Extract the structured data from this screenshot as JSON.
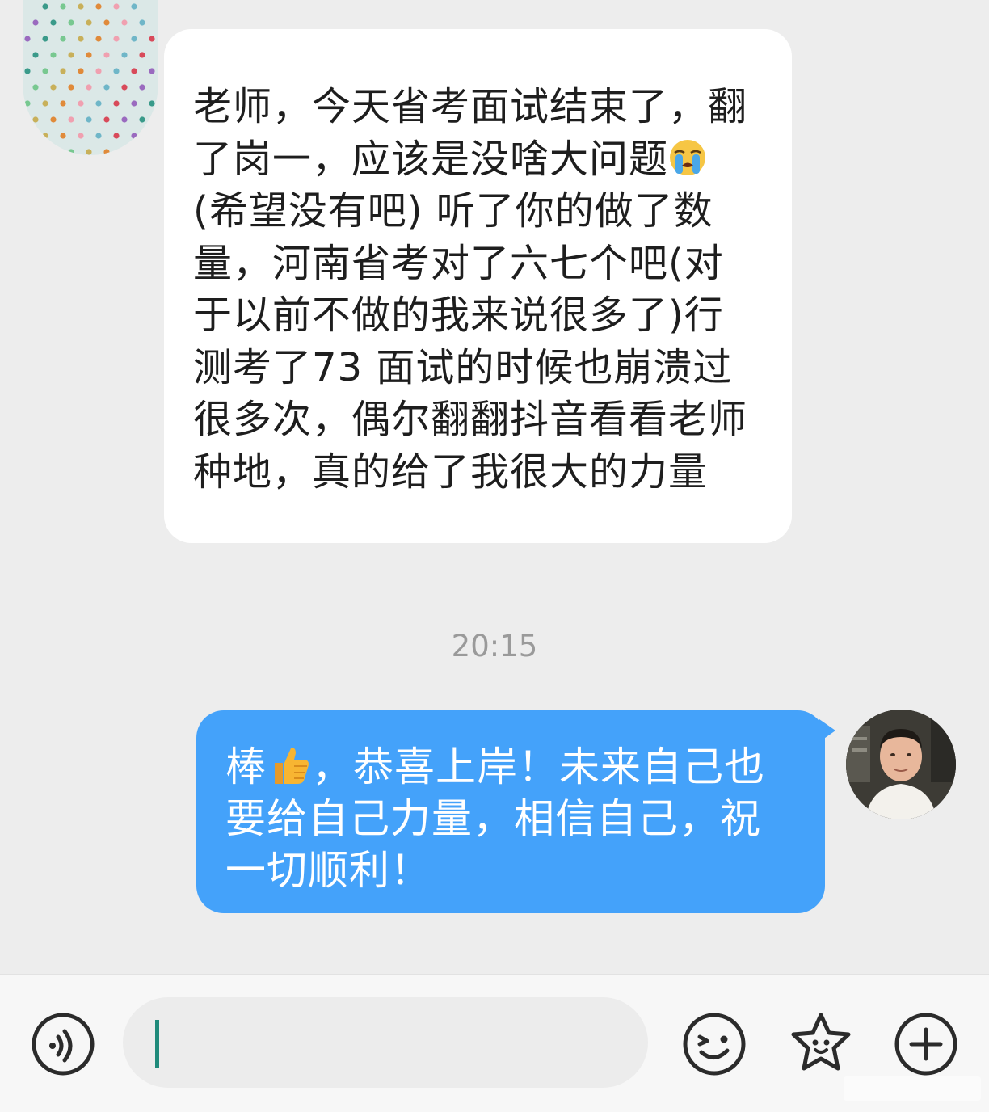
{
  "conversation": {
    "incoming": {
      "avatar": "polka-dot-avatar",
      "text_before_emoji": "老师，今天省考面试结束了，翻了岗一，应该是没啥大问题",
      "emoji": "loudly-crying-face",
      "text_after_emoji": "(希望没有吧) 听了你的做了数量，河南省考对了六七个吧(对于以前不做的我来说很多了)行测考了73 面试的时候也崩溃过很多次，偶尔翻翻抖音看看老师种地，真的给了我很大的力量"
    },
    "timestamp": "20:15",
    "outgoing": {
      "avatar": "teacher-photo-avatar",
      "text_before_emoji": "棒",
      "emoji": "thumbs-up",
      "text_after_emoji": "，恭喜上岸！未来自己也要给自己力量，相信自己，祝一切顺利！",
      "bubble_color": "#44a2fa"
    }
  },
  "input_bar": {
    "voice_button": "voice-icon",
    "input_value": "",
    "emoji_button": "smiley-icon",
    "sticker_button": "star-face-icon",
    "more_button": "plus-icon"
  }
}
